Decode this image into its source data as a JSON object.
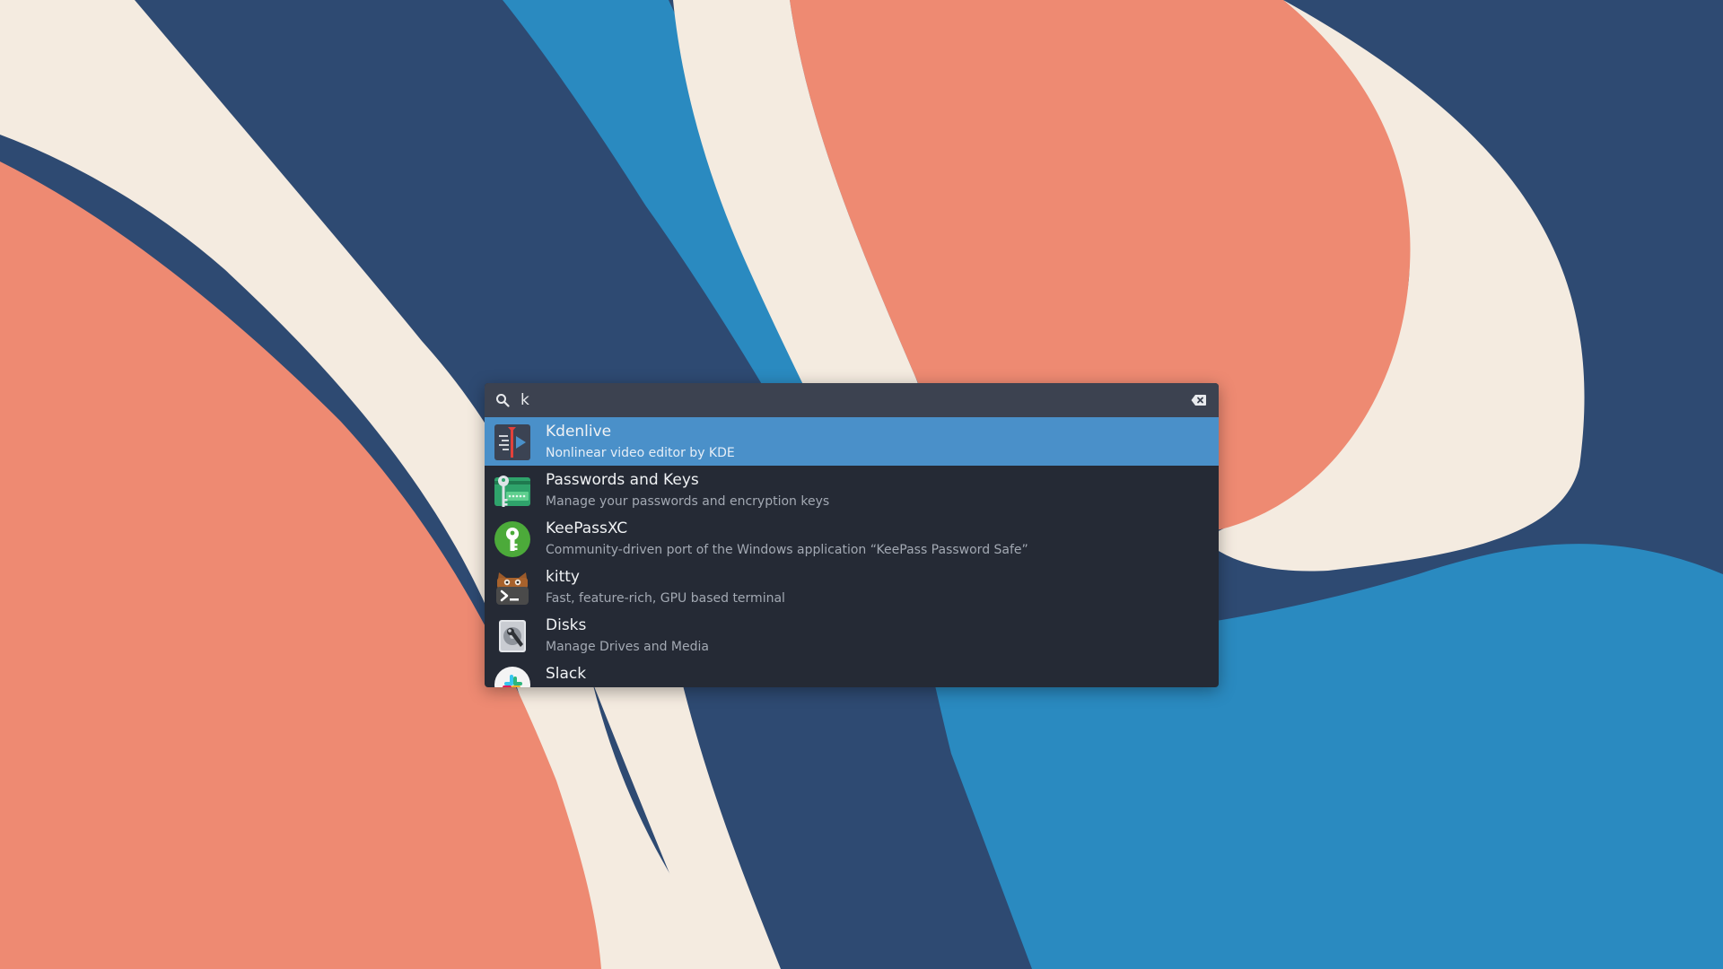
{
  "search": {
    "query": "k",
    "icon": "search-icon",
    "clear_icon": "backspace-clear-icon"
  },
  "results": [
    {
      "name": "Kdenlive",
      "description": "Nonlinear video editor by KDE",
      "icon": "kdenlive-icon",
      "selected": true
    },
    {
      "name": "Passwords and Keys",
      "description": "Manage your passwords and encryption keys",
      "icon": "passwords-and-keys-icon",
      "selected": false
    },
    {
      "name": "KeePassXC",
      "description": "Community-driven port of the Windows application “KeePass Password Safe”",
      "icon": "keepassxc-icon",
      "selected": false
    },
    {
      "name": "kitty",
      "description": "Fast, feature-rich, GPU based terminal",
      "icon": "kitty-icon",
      "selected": false
    },
    {
      "name": "Disks",
      "description": "Manage Drives and Media",
      "icon": "disks-icon",
      "selected": false
    },
    {
      "name": "Slack",
      "description": "",
      "icon": "slack-icon",
      "selected": false
    }
  ],
  "colors": {
    "wallpaper_navy": "#2e4a72",
    "wallpaper_blue": "#2a8ac0",
    "wallpaper_cream": "#f4ebe0",
    "wallpaper_coral": "#ee8a72",
    "launcher_bg": "#252a35",
    "search_bg": "#3c4250",
    "selection": "#4a90c9"
  }
}
